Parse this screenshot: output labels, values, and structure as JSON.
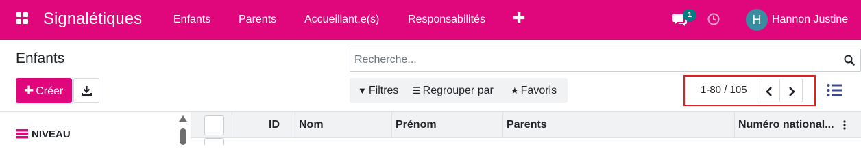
{
  "navbar": {
    "app_title": "Signalétiques",
    "menu": [
      "Enfants",
      "Parents",
      "Accueillant.e(s)",
      "Responsabilités"
    ],
    "add_icon": "plus-icon",
    "messages_badge": "1",
    "user_initial": "H",
    "user_name": "Hannon Justine",
    "accent_color": "#e0077d"
  },
  "control_panel": {
    "title": "Enfants",
    "search_placeholder": "Recherche...",
    "create_label": "Créer",
    "filters": {
      "filters_label": "Filtres",
      "group_by_label": "Regrouper par",
      "favorites_label": "Favoris"
    },
    "pager": {
      "value": "1-80 / 105"
    }
  },
  "sidebar": {
    "section_title": "NIVEAU"
  },
  "table": {
    "columns": [
      "ID",
      "Nom",
      "Prénom",
      "Parents",
      "Numéro national..."
    ]
  }
}
